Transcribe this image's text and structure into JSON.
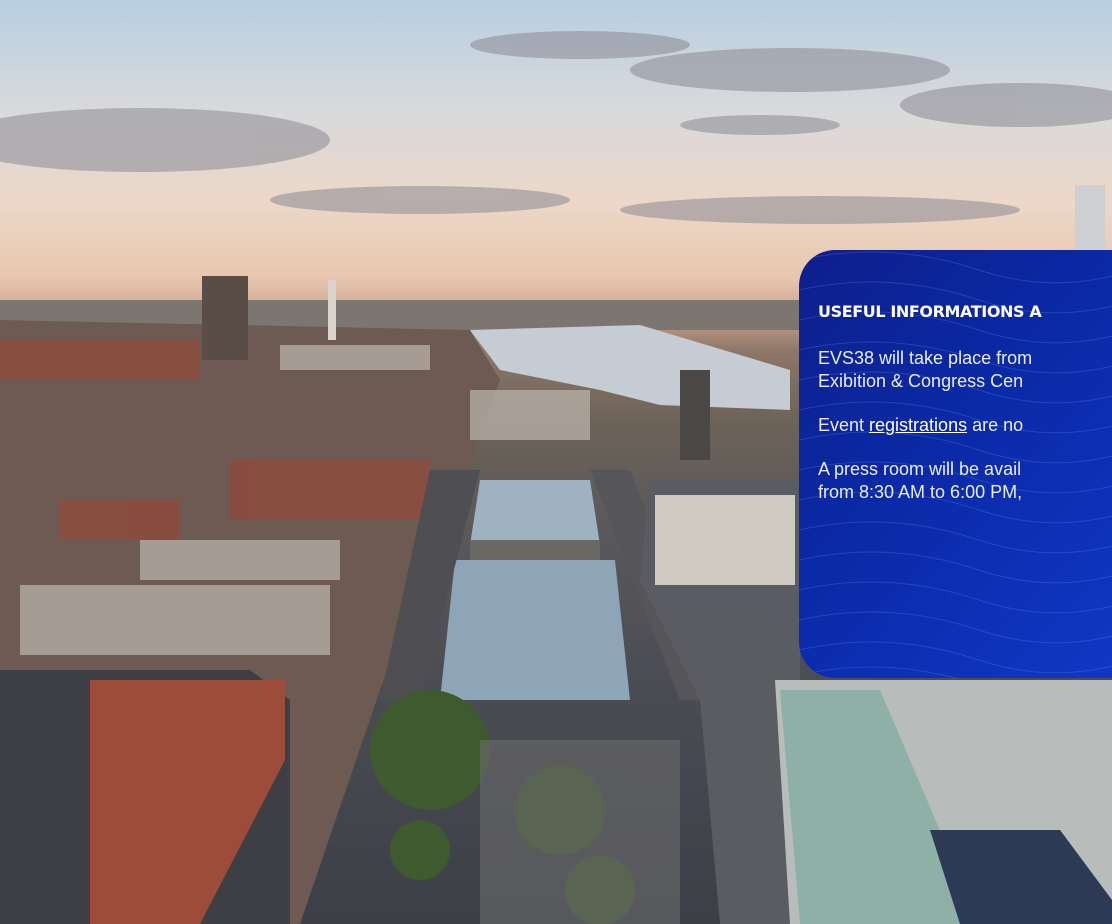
{
  "info_card": {
    "title": "USEFUL INFORMATIONS A",
    "line1a": "EVS38 will take place from",
    "line1b": "Exibition & Congress Cen",
    "line2_prefix": "Event ",
    "line2_link": "registrations",
    "line2_suffix": " are no",
    "line3a": "A press room will be avail",
    "line3b": "from 8:30 AM to 6:00 PM,"
  },
  "colors": {
    "card_blue": "#0a2aa8",
    "card_text": "#ffffff"
  }
}
